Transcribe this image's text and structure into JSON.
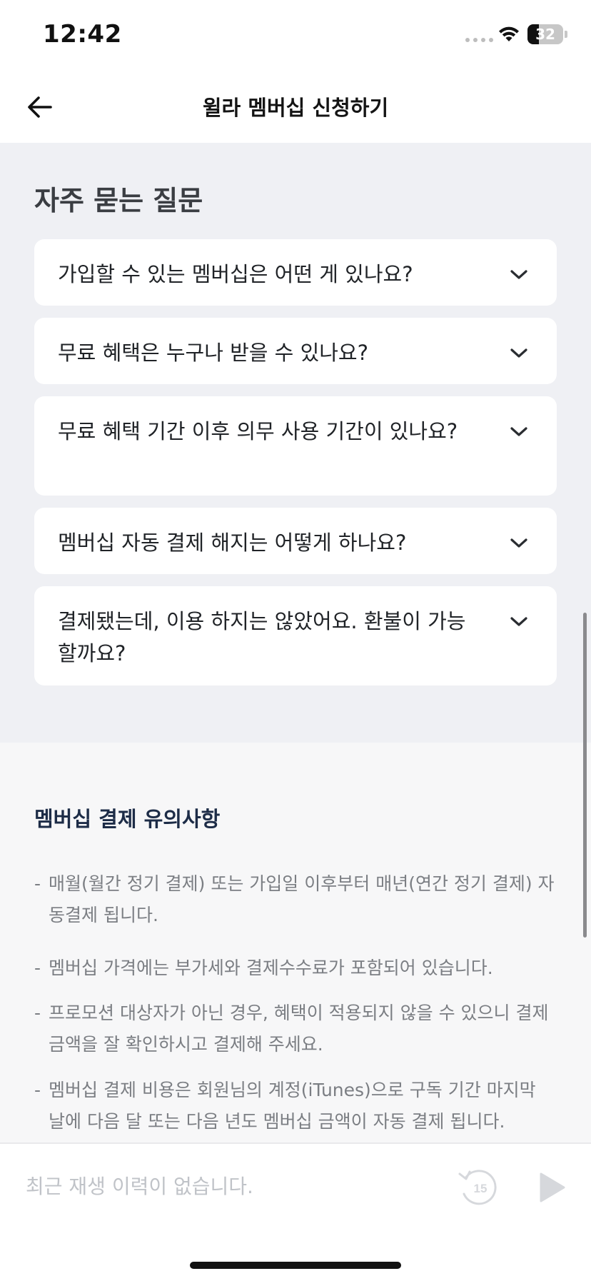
{
  "status_bar": {
    "time": "12:42",
    "battery": "32"
  },
  "nav": {
    "title": "윌라 멤버십 신청하기"
  },
  "faq": {
    "heading": "자주 묻는 질문",
    "items": [
      {
        "question": "가입할 수 있는 멤버십은 어떤 게 있나요?"
      },
      {
        "question": "무료 혜택은 누구나 받을 수 있나요?"
      },
      {
        "question": "무료 혜택 기간 이후 의무 사용 기간이 있나요?"
      },
      {
        "question": "멤버십 자동 결제 해지는 어떻게 하나요?"
      },
      {
        "question": "결제됐는데, 이용 하지는 않았어요. 환불이 가능할까요?"
      }
    ]
  },
  "notice": {
    "title": "멤버십 결제 유의사항",
    "bullet": "-",
    "items": [
      "매월(월간 정기 결제) 또는 가입일 이후부터 매년(연간 정기 결제) 자동결제 됩니다.",
      "멤버십 가격에는 부가세와 결제수수료가 포함되어 있습니다.",
      "프로모션 대상자가 아닌 경우, 혜택이 적용되지 않을 수 있으니 결제금액을 잘 확인하시고 결제해 주세요.",
      "멤버십 결제 비용은 회원님의 계정(iTunes)으로 구독 기간 마지막 날에 다음 달 또는 다음 년도 멤버십 금액이 자동 결제 됩니다."
    ]
  },
  "player": {
    "empty_text": "최근 재생 이력이 없습니다.",
    "rewind_seconds": "15"
  },
  "icons": {
    "back": "arrow-left-icon",
    "chevron": "chevron-down-icon",
    "wifi": "wifi-icon",
    "rewind": "rewind-15-icon",
    "play": "play-icon"
  },
  "colors": {
    "faq_background": "#eff0f4",
    "notice_background": "#f7f7f8",
    "notice_title": "#1d2c47",
    "disabled": "#c0c3c8"
  }
}
